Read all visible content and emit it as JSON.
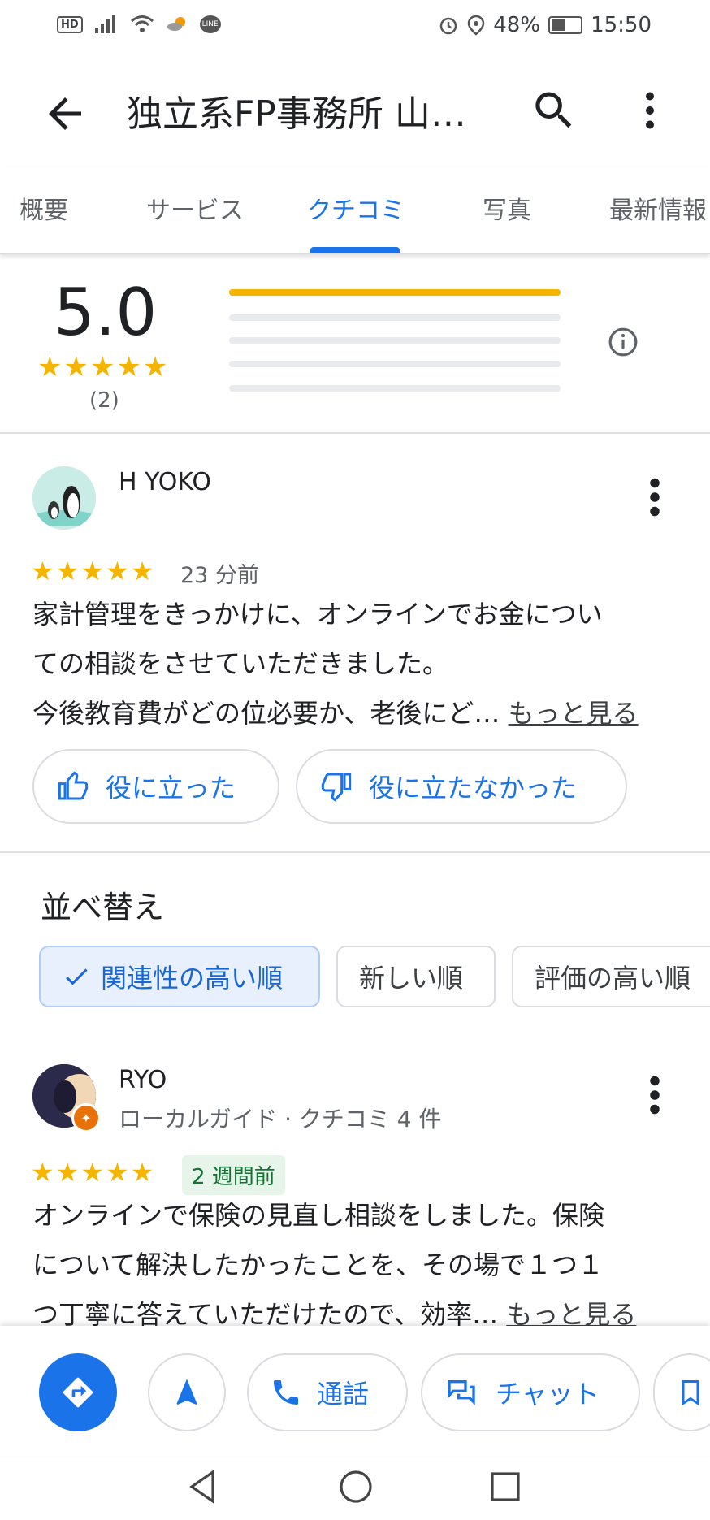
{
  "status_bar": {
    "hd": "HD",
    "line_app": "LINE",
    "battery": "48%",
    "time": "15:50"
  },
  "header": {
    "title": "独立系FP事務所 山下…"
  },
  "tabs": [
    {
      "label": "概要"
    },
    {
      "label": "サービス"
    },
    {
      "label": "クチコミ"
    },
    {
      "label": "写真"
    },
    {
      "label": "最新情報"
    }
  ],
  "summary": {
    "score": "5.0",
    "stars": "★★★★★",
    "count": "(2)",
    "distribution": [
      1.0,
      0,
      0,
      0,
      0
    ],
    "accent": "#f4b400"
  },
  "review1": {
    "name": "H YOKO",
    "stars": "★★★★★",
    "time": "23 分前",
    "text_lines": [
      "家計管理をきっかけに、オンラインでお金につい",
      "ての相談をさせていただきました。",
      "今後教育費がどの位必要か、老後にど…"
    ],
    "more": "もっと見る",
    "helpful": "役に立った",
    "not_helpful": "役に立たなかった"
  },
  "sort": {
    "title": "並べ替え",
    "chips": [
      {
        "label": "関連性の高い順",
        "selected": true
      },
      {
        "label": "新しい順",
        "selected": false
      },
      {
        "label": "評価の高い順",
        "selected": false
      }
    ]
  },
  "review2": {
    "name": "RYO",
    "subtitle": "ローカルガイド · クチコミ 4 件",
    "stars": "★★★★★",
    "time": "2 週間前",
    "text_lines": [
      "オンラインで保険の見直し相談をしました。保険",
      "について解決したかったことを、その場で１つ１",
      "つ丁寧に答えていただけたので、効率…"
    ],
    "more": "もっと見る"
  },
  "actions": {
    "call": "通話",
    "chat": "チャット"
  },
  "colors": {
    "primary": "#1a73e8",
    "star": "#f4b400"
  }
}
